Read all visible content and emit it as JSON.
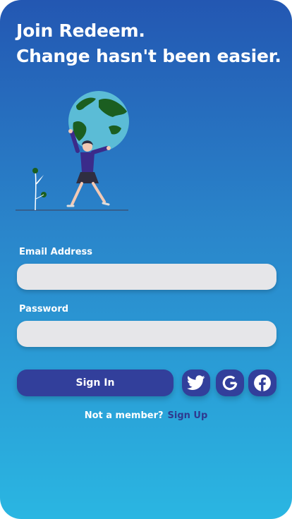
{
  "header": {
    "line1": "Join Redeem.",
    "line2": "Change hasn't been easier."
  },
  "illustration": {
    "icon": "woman-holding-globe-illustration"
  },
  "form": {
    "email_label": "Email Address",
    "email_value": "",
    "email_placeholder": "",
    "password_label": "Password",
    "password_value": "",
    "password_placeholder": "",
    "signin_label": "Sign In"
  },
  "social": [
    {
      "icon": "twitter-icon"
    },
    {
      "icon": "google-icon"
    },
    {
      "icon": "facebook-icon"
    }
  ],
  "footer": {
    "prompt": "Not a member?",
    "signup_label": "Sign Up"
  },
  "colors": {
    "gradient_top": "#2357b2",
    "gradient_bottom": "#2ab6e2",
    "button": "#323f9b",
    "input_bg": "#e6e6e9",
    "link": "#2f3a8f"
  }
}
